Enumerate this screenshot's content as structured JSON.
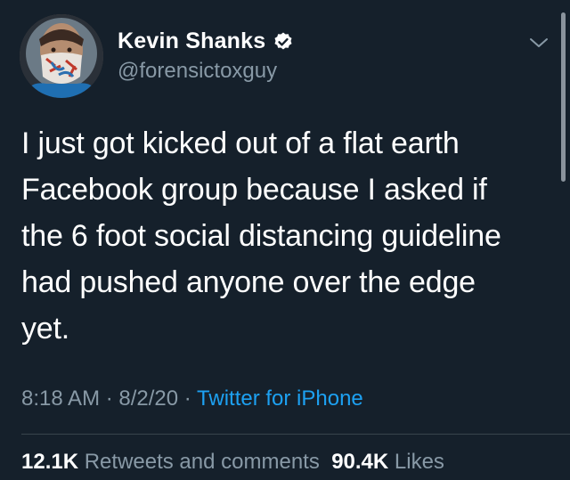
{
  "author": {
    "display_name": "Kevin Shanks",
    "handle": "@forensictoxguy",
    "verified": true
  },
  "icons": {
    "verified": "verified-badge-icon",
    "menu": "chevron-down-icon"
  },
  "tweet": {
    "text": "I just got kicked out of a flat earth\nFacebook group because I asked if\nthe 6 foot social distancing guideline\nhad pushed anyone over the edge\nyet."
  },
  "meta": {
    "time": "8:18 AM",
    "separator": " · ",
    "date": "8/2/20",
    "source": "Twitter for iPhone"
  },
  "stats": {
    "retweets_count": "12.1K",
    "retweets_label": "Retweets and comments",
    "likes_count": "90.4K",
    "likes_label": "Likes"
  },
  "colors": {
    "background": "#15202b",
    "secondary_text": "#8899a6",
    "link": "#1da1f2",
    "divider": "#38444d"
  }
}
